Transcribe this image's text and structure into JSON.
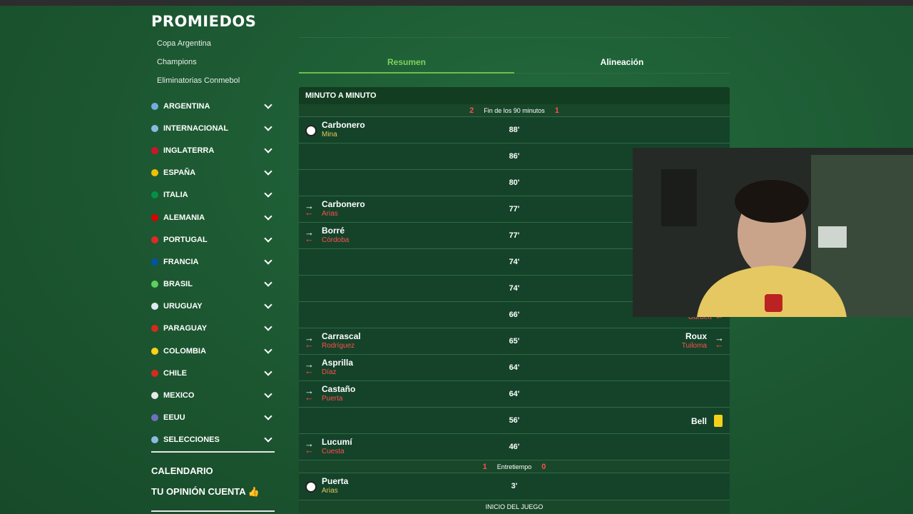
{
  "app": {
    "logo": "PROMIEDOS"
  },
  "sidebar": {
    "links": [
      "Copa Argentina",
      "Champions",
      "Eliminatorias Conmebol"
    ],
    "countries": [
      {
        "name": "ARGENTINA",
        "color": "#74acdf"
      },
      {
        "name": "INTERNACIONAL",
        "color": "#8fb8e0"
      },
      {
        "name": "INGLATERRA",
        "color": "#cf142b"
      },
      {
        "name": "ESPAÑA",
        "color": "#f1bf00"
      },
      {
        "name": "ITALIA",
        "color": "#009246"
      },
      {
        "name": "ALEMANIA",
        "color": "#dd0000"
      },
      {
        "name": "PORTUGAL",
        "color": "#e02a2a"
      },
      {
        "name": "FRANCIA",
        "color": "#0055a4"
      },
      {
        "name": "BRASIL",
        "color": "#5bd25b"
      },
      {
        "name": "URUGUAY",
        "color": "#dfe8f4"
      },
      {
        "name": "PARAGUAY",
        "color": "#d52b1e"
      },
      {
        "name": "COLOMBIA",
        "color": "#fcd116"
      },
      {
        "name": "CHILE",
        "color": "#d52b1e"
      },
      {
        "name": "MEXICO",
        "color": "#e8e8e8"
      },
      {
        "name": "EEUU",
        "color": "#6f6fbf"
      },
      {
        "name": "SELECCIONES",
        "color": "#8fb8e0"
      }
    ],
    "calendario": "CALENDARIO",
    "opinion": "TU OPINIÓN CUENTA 👍"
  },
  "tabs": {
    "resumen": "Resumen",
    "alineacion": "Alineación"
  },
  "timeline": {
    "header": "MINUTO A MINUTO",
    "end_sep": {
      "home": "2",
      "label": "Fin de los 90 minutos",
      "away": "1"
    },
    "half_sep": {
      "home": "1",
      "label": "Entretiempo",
      "away": "0"
    },
    "start_label": "INICIO DEL JUEGO",
    "rows": [
      {
        "minute": "88'",
        "type": "goal",
        "p1": "Carbonero",
        "p2": "Mina"
      },
      {
        "minute": "86'",
        "type": "empty"
      },
      {
        "minute": "80'",
        "type": "empty"
      },
      {
        "minute": "77'",
        "type": "sub",
        "p1": "Carbonero",
        "p2": "Arias"
      },
      {
        "minute": "77'",
        "type": "sub",
        "p1": "Borré",
        "p2": "Córdoba"
      },
      {
        "minute": "74'",
        "type": "empty"
      },
      {
        "minute": "74'",
        "type": "empty"
      },
      {
        "minute": "66'",
        "type": "right-out",
        "r2": "Garbett"
      },
      {
        "minute": "65'",
        "type": "sub-both",
        "p1": "Carrascal",
        "p2": "Rodríguez",
        "r1": "Roux",
        "r2": "Tuiloma"
      },
      {
        "minute": "64'",
        "type": "sub",
        "p1": "Asprilla",
        "p2": "Díaz"
      },
      {
        "minute": "64'",
        "type": "sub",
        "p1": "Castaño",
        "p2": "Puerta"
      },
      {
        "minute": "56'",
        "type": "card-right",
        "r1": "Bell"
      },
      {
        "minute": "46'",
        "type": "sub",
        "p1": "Lucumí",
        "p2": "Cuesta"
      }
    ],
    "first_goal": {
      "minute": "3'",
      "p1": "Puerta",
      "p2": "Arias"
    }
  }
}
